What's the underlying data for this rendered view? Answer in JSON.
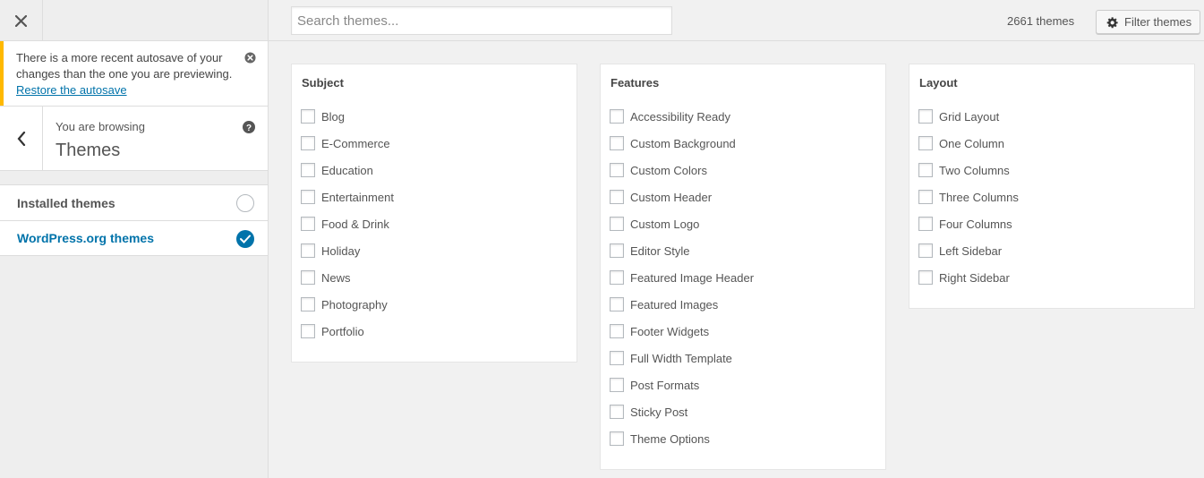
{
  "sidebar": {
    "notice": {
      "message": "There is a more recent autosave of your changes than the one you are previewing.",
      "link": "Restore the autosave"
    },
    "browsing": {
      "pre": "You are browsing",
      "title": "Themes"
    },
    "sources": [
      {
        "label": "Installed themes",
        "selected": false
      },
      {
        "label": "WordPress.org themes",
        "selected": true
      }
    ]
  },
  "topbar": {
    "search_placeholder": "Search themes...",
    "count": "2661 themes",
    "filter_label": "Filter themes"
  },
  "filters": {
    "subject": {
      "title": "Subject",
      "items": [
        "Blog",
        "E-Commerce",
        "Education",
        "Entertainment",
        "Food & Drink",
        "Holiday",
        "News",
        "Photography",
        "Portfolio"
      ]
    },
    "features": {
      "title": "Features",
      "items": [
        "Accessibility Ready",
        "Custom Background",
        "Custom Colors",
        "Custom Header",
        "Custom Logo",
        "Editor Style",
        "Featured Image Header",
        "Featured Images",
        "Footer Widgets",
        "Full Width Template",
        "Post Formats",
        "Sticky Post",
        "Theme Options"
      ]
    },
    "layout": {
      "title": "Layout",
      "items": [
        "Grid Layout",
        "One Column",
        "Two Columns",
        "Three Columns",
        "Four Columns",
        "Left Sidebar",
        "Right Sidebar"
      ]
    }
  },
  "colors": {
    "accent": "#0073aa",
    "notice_border": "#ffb900"
  }
}
